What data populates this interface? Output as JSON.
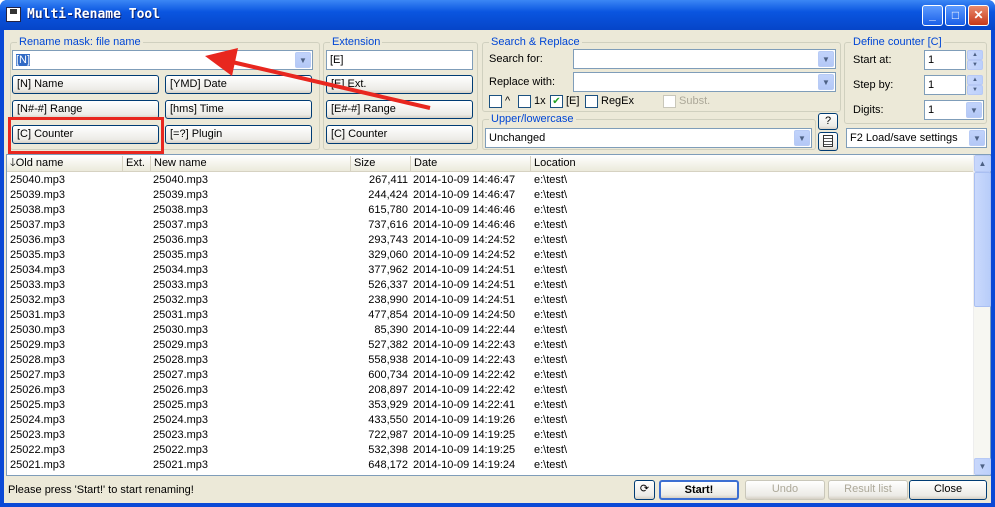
{
  "window": {
    "title": "Multi-Rename Tool"
  },
  "titlebar_buttons": {
    "minimize": "_",
    "maximize": "□",
    "close": "✕"
  },
  "rename_mask": {
    "group_label": "Rename mask: file name",
    "value": "[N]",
    "buttons": [
      "[N]  Name",
      "[YMD]  Date",
      "[N#-#]  Range",
      "[hms]  Time",
      "[C]  Counter",
      "[=?]  Plugin"
    ]
  },
  "extension": {
    "group_label": "Extension",
    "value": "[E]",
    "buttons": [
      "[E]  Ext.",
      "[E#-#]  Range",
      "[C]  Counter"
    ]
  },
  "search_replace": {
    "group_label": "Search & Replace",
    "search_label": "Search for:",
    "search_value": "",
    "replace_label": "Replace with:",
    "replace_value": "",
    "options": [
      {
        "label": "^",
        "checked": false
      },
      {
        "label": "1x",
        "checked": false
      },
      {
        "label": "[E]",
        "checked": true
      },
      {
        "label": "RegEx",
        "checked": false
      },
      {
        "label": "Subst.",
        "checked": false,
        "disabled": true
      }
    ]
  },
  "case": {
    "group_label": "Upper/lowercase",
    "value": "Unchanged",
    "help_button": "?"
  },
  "counter": {
    "group_label": "Define counter [C]",
    "start_label": "Start at:",
    "start_value": "1",
    "step_label": "Step by:",
    "step_value": "1",
    "digits_label": "Digits:",
    "digits_value": "1"
  },
  "settings": {
    "value": "F2 Load/save settings"
  },
  "list": {
    "columns": [
      "Old name",
      "Ext.",
      "New name",
      "Size",
      "Date",
      "Location"
    ],
    "rows": [
      [
        "25040.mp3",
        "",
        "25040.mp3",
        "267,411",
        "2014-10-09 14:46:47",
        "e:\\test\\"
      ],
      [
        "25039.mp3",
        "",
        "25039.mp3",
        "244,424",
        "2014-10-09 14:46:47",
        "e:\\test\\"
      ],
      [
        "25038.mp3",
        "",
        "25038.mp3",
        "615,780",
        "2014-10-09 14:46:46",
        "e:\\test\\"
      ],
      [
        "25037.mp3",
        "",
        "25037.mp3",
        "737,616",
        "2014-10-09 14:46:46",
        "e:\\test\\"
      ],
      [
        "25036.mp3",
        "",
        "25036.mp3",
        "293,743",
        "2014-10-09 14:24:52",
        "e:\\test\\"
      ],
      [
        "25035.mp3",
        "",
        "25035.mp3",
        "329,060",
        "2014-10-09 14:24:52",
        "e:\\test\\"
      ],
      [
        "25034.mp3",
        "",
        "25034.mp3",
        "377,962",
        "2014-10-09 14:24:51",
        "e:\\test\\"
      ],
      [
        "25033.mp3",
        "",
        "25033.mp3",
        "526,337",
        "2014-10-09 14:24:51",
        "e:\\test\\"
      ],
      [
        "25032.mp3",
        "",
        "25032.mp3",
        "238,990",
        "2014-10-09 14:24:51",
        "e:\\test\\"
      ],
      [
        "25031.mp3",
        "",
        "25031.mp3",
        "477,854",
        "2014-10-09 14:24:50",
        "e:\\test\\"
      ],
      [
        "25030.mp3",
        "",
        "25030.mp3",
        "85,390",
        "2014-10-09 14:22:44",
        "e:\\test\\"
      ],
      [
        "25029.mp3",
        "",
        "25029.mp3",
        "527,382",
        "2014-10-09 14:22:43",
        "e:\\test\\"
      ],
      [
        "25028.mp3",
        "",
        "25028.mp3",
        "558,938",
        "2014-10-09 14:22:43",
        "e:\\test\\"
      ],
      [
        "25027.mp3",
        "",
        "25027.mp3",
        "600,734",
        "2014-10-09 14:22:42",
        "e:\\test\\"
      ],
      [
        "25026.mp3",
        "",
        "25026.mp3",
        "208,897",
        "2014-10-09 14:22:42",
        "e:\\test\\"
      ],
      [
        "25025.mp3",
        "",
        "25025.mp3",
        "353,929",
        "2014-10-09 14:22:41",
        "e:\\test\\"
      ],
      [
        "25024.mp3",
        "",
        "25024.mp3",
        "433,550",
        "2014-10-09 14:19:26",
        "e:\\test\\"
      ],
      [
        "25023.mp3",
        "",
        "25023.mp3",
        "722,987",
        "2014-10-09 14:19:25",
        "e:\\test\\"
      ],
      [
        "25022.mp3",
        "",
        "25022.mp3",
        "532,398",
        "2014-10-09 14:19:25",
        "e:\\test\\"
      ],
      [
        "25021.mp3",
        "",
        "25021.mp3",
        "648,172",
        "2014-10-09 14:19:24",
        "e:\\test\\"
      ]
    ]
  },
  "footer": {
    "status": "Please press 'Start!' to start renaming!",
    "start": "Start!",
    "undo": "Undo",
    "result_list": "Result list",
    "close": "Close"
  },
  "annotation": {
    "color": "#e8271f"
  }
}
